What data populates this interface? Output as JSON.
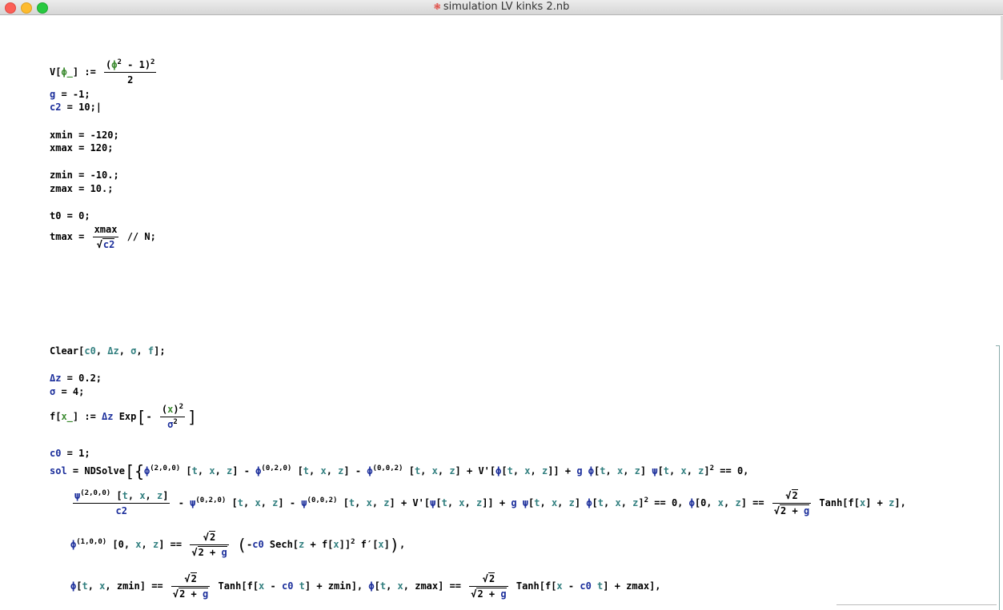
{
  "window": {
    "title": "simulation LV kinks 2.nb",
    "icon": "notebook-icon"
  },
  "lines": {
    "l1": "V[ϕ_] := (ϕ² − 1)² / 2",
    "l2": "g = -1;",
    "l3": "c2 = 10;",
    "l4": "xmin = -120;",
    "l5": "xmax = 120;",
    "l6": "zmin = -10.;",
    "l7": "zmax = 10.;",
    "l8": "t0 = 0;",
    "l9": "tmax = xmax / √c2 // N;",
    "l10": "Clear[c0, Δz, σ, f];",
    "l11": "Δz = 0.2;",
    "l12": "σ = 4;",
    "l13": "f[x_] := Δz Exp[-(x)²/σ²]",
    "l14": "c0 = 1;",
    "l15": "sol = NDSolve[{ϕ^(2,0,0)[t, x, z] - ϕ^(0,2,0)[t, x, z] - ϕ^(0,0,2)[t, x, z] + V'[ϕ[t, x, z]] + g ϕ[t, x, z] ψ[t, x, z]² == 0,",
    "l16": "ψ^(2,0,0)[t, x, z]/c2 - ψ^(0,2,0)[t, x, z] - ψ^(0,0,2)[t, x, z] + V'[ψ[t, x, z]] + g ψ[t, x, z] ϕ[t, x, z]² == 0, ϕ[0, x, z] == √2/√(2+g) Tanh[f[x] + z],",
    "l17": "ϕ^(1,0,0)[0, x, z] == √2/√(2+g) (-c0 Sech[z + f[x]]² f'[x]),",
    "l18": "ϕ[t, x, zmin] == √2/√(2+g) Tanh[f[x - c0 t] + zmin], ϕ[t, x, zmax] == √2/√(2+g) Tanh[f[x - c0 t] + zmax],"
  }
}
